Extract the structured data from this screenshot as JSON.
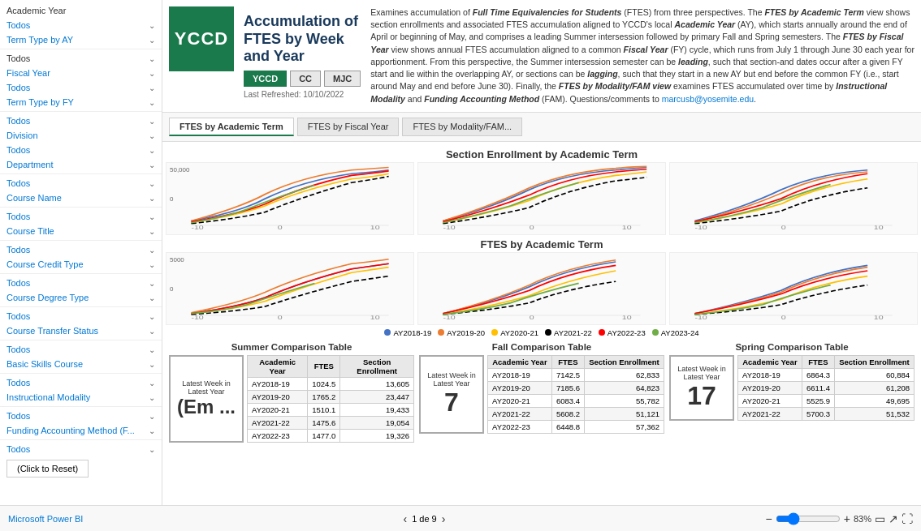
{
  "app": {
    "powerbi_link": "Microsoft Power BI",
    "nav_page": "1 de 9"
  },
  "header": {
    "logo": "YCCD",
    "logo_bg": "#1a7a4c",
    "title_line1": "Accumulation of",
    "title_line2": "FTES by Week",
    "title_line3": "and Year",
    "buttons": [
      "YCCD",
      "CC",
      "MJC"
    ],
    "active_button": "YCCD",
    "refresh": "Last Refreshed: 10/10/2022",
    "description": "Examines accumulation of Full Time Equivalencies for Students (FTES) from three perspectives. The FTES by Academic Term view shows section enrollments and associated FTES accumulation aligned to YCCD's local Academic Year (AY), which starts annually around the end of April or beginning of May, and comprises a leading Summer intersession followed by primary Fall and Spring semesters. The FTES by Fiscal Year view shows annual FTES accumulation aligned to a common Fiscal Year (FY) cycle, which runs from July 1 through June 30 each year for apportionment. From this perspective, the Summer intersession semester can be leading, such that section-and dates occur after a given FY start and lie within the overlapping AY, or sections can be lagging, such that they start in a new AY but end before the common FY (i.e., start around May and end before June 30). Finally, the FTES by Modality/FAM view examines FTES accumulated over time by Instructional Modality and Funding Accounting Method (FAM). Questions/comments to marcusb@yosemite.edu."
  },
  "tabs": [
    {
      "label": "FTES by Academic Term",
      "active": true
    },
    {
      "label": "FTES by Fiscal Year",
      "active": false
    },
    {
      "label": "FTES by Modality/FAM...",
      "active": false
    }
  ],
  "charts": {
    "section_enrollment_title": "Section Enrollment by Academic Term",
    "ftes_title": "FTES by Academic Term",
    "legend": [
      {
        "label": "AY2018-19",
        "color": "#4472C4"
      },
      {
        "label": "AY2019-20",
        "color": "#ED7D31"
      },
      {
        "label": "AY2020-21",
        "color": "#FFC000"
      },
      {
        "label": "AY2021-22",
        "color": "#000000"
      },
      {
        "label": "AY2022-23",
        "color": "#FF0000"
      },
      {
        "label": "AY2023-24",
        "color": "#70AD47"
      }
    ],
    "enroll_ymax": "50,000",
    "enroll_y0": "0",
    "ftes_ymax": "5000",
    "ftes_y0": "0",
    "x_labels": [
      "-10",
      "0",
      "10"
    ]
  },
  "sidebar": {
    "items": [
      {
        "type": "label",
        "text": "Academic Year"
      },
      {
        "type": "filter",
        "label": "Todos",
        "has_chevron": true
      },
      {
        "type": "filter",
        "label": "Term Type by AY",
        "has_chevron": true
      },
      {
        "type": "label_blue",
        "text": "Fiscal Year"
      },
      {
        "type": "filter",
        "label": "Todos",
        "has_chevron": true
      },
      {
        "type": "filter",
        "label": "Term Type by FY",
        "has_chevron": true
      },
      {
        "type": "label_blue",
        "text": "Division"
      },
      {
        "type": "filter",
        "label": "Todos",
        "has_chevron": true
      },
      {
        "type": "filter",
        "label": "Department",
        "has_chevron": true
      },
      {
        "type": "filter",
        "label": "Todos",
        "has_chevron": true
      },
      {
        "type": "filter",
        "label": "Course Name",
        "has_chevron": true
      },
      {
        "type": "filter",
        "label": "Todos",
        "has_chevron": true
      },
      {
        "type": "filter",
        "label": "Course Title",
        "has_chevron": true
      },
      {
        "type": "filter",
        "label": "Todos",
        "has_chevron": true
      },
      {
        "type": "filter",
        "label": "Course Credit Type",
        "has_chevron": true
      },
      {
        "type": "filter",
        "label": "Todos",
        "has_chevron": true
      },
      {
        "type": "filter",
        "label": "Course Degree Type",
        "has_chevron": true
      },
      {
        "type": "filter",
        "label": "Todos",
        "has_chevron": true
      },
      {
        "type": "filter",
        "label": "Course Transfer Status",
        "has_chevron": true
      },
      {
        "type": "filter",
        "label": "Todos",
        "has_chevron": true
      },
      {
        "type": "filter",
        "label": "Basic Skills Course",
        "has_chevron": true
      },
      {
        "type": "filter",
        "label": "Todos",
        "has_chevron": true
      },
      {
        "type": "filter",
        "label": "Instructional Modality",
        "has_chevron": true
      },
      {
        "type": "filter",
        "label": "Todos",
        "has_chevron": true
      },
      {
        "type": "filter",
        "label": "Funding Accounting Method (F...",
        "has_chevron": true
      },
      {
        "type": "filter",
        "label": "Todos",
        "has_chevron": true
      }
    ],
    "reset_btn": "(Click to Reset)"
  },
  "tables": {
    "summer": {
      "title": "Summer Comparison Table",
      "badge_lines": [
        "Latest Week in",
        "Latest Year"
      ],
      "badge_value": "(Em ...",
      "columns": [
        "Academic Year",
        "FTES",
        "Section Enrollment"
      ],
      "rows": [
        [
          "AY2018-19",
          "1024.5",
          "13,605"
        ],
        [
          "AY2019-20",
          "1765.2",
          "23,447"
        ],
        [
          "AY2020-21",
          "1510.1",
          "19,433"
        ],
        [
          "AY2021-22",
          "1475.6",
          "19,054"
        ],
        [
          "AY2022-23",
          "1477.0",
          "19,326"
        ]
      ]
    },
    "fall": {
      "title": "Fall Comparison Table",
      "badge_lines": [
        "Latest Week in",
        "Latest Year"
      ],
      "badge_value": "7",
      "columns": [
        "Academic Year",
        "FTES",
        "Section Enrollment"
      ],
      "rows": [
        [
          "AY2018-19",
          "7142.5",
          "62,833"
        ],
        [
          "AY2019-20",
          "7185.6",
          "64,823"
        ],
        [
          "AY2020-21",
          "6083.4",
          "55,782"
        ],
        [
          "AY2021-22",
          "5608.2",
          "51,121"
        ],
        [
          "AY2022-23",
          "6448.8",
          "57,362"
        ]
      ]
    },
    "spring": {
      "title": "Spring Comparison Table",
      "badge_lines": [
        "Latest Week in",
        "Latest Year"
      ],
      "badge_value": "17",
      "columns": [
        "Academic Year",
        "FTES",
        "Section Enrollment"
      ],
      "rows": [
        [
          "AY2018-19",
          "6864.3",
          "60,884"
        ],
        [
          "AY2019-20",
          "6611.4",
          "61,208"
        ],
        [
          "AY2020-21",
          "5525.9",
          "49,695"
        ],
        [
          "AY2021-22",
          "5700.3",
          "51,532"
        ]
      ]
    }
  },
  "zoom": {
    "value": "83%"
  }
}
